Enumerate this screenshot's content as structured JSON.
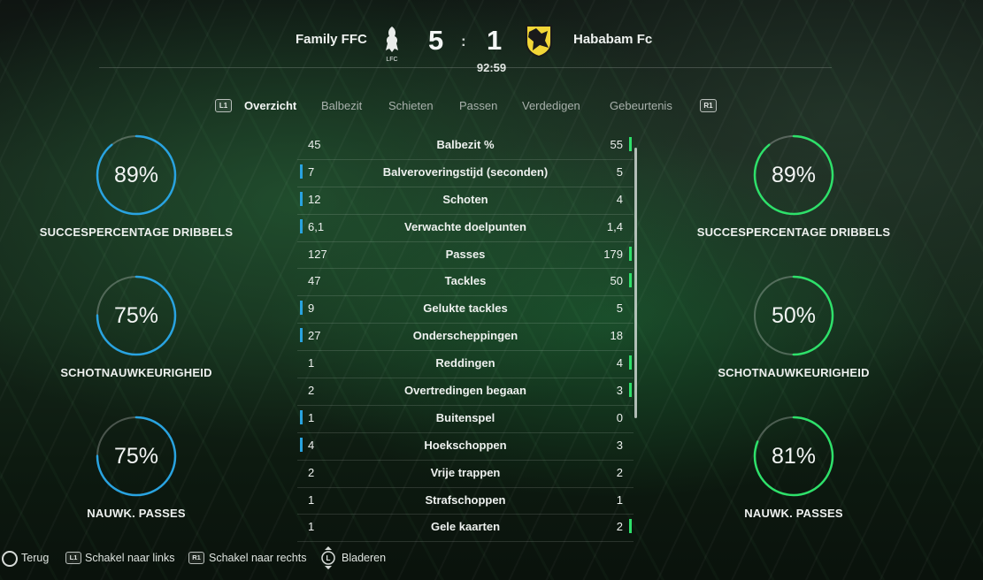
{
  "match": {
    "home_team": "Family FFC",
    "away_team": "Hababam Fc",
    "home_score": "5",
    "away_score": "1",
    "separator": ":",
    "clock": "92:59",
    "home_crest_text": "LFC"
  },
  "tabs": {
    "left_button": "L1",
    "right_button": "R1",
    "items": [
      "Overzicht",
      "Balbezit",
      "Schieten",
      "Passen",
      "Verdedigen",
      "Gebeurtenis"
    ],
    "active": "Overzicht"
  },
  "left_circles": [
    {
      "pct": "89%",
      "value": 0.89,
      "label": "SUCCESPERCENTAGE DRIBBELS"
    },
    {
      "pct": "75%",
      "value": 0.75,
      "label": "SCHOTNAUWKEURIGHEID"
    },
    {
      "pct": "75%",
      "value": 0.75,
      "label": "NAUWK. PASSES"
    }
  ],
  "right_circles": [
    {
      "pct": "89%",
      "value": 0.89,
      "label": "SUCCESPERCENTAGE DRIBBELS"
    },
    {
      "pct": "50%",
      "value": 0.5,
      "label": "SCHOTNAUWKEURIGHEID"
    },
    {
      "pct": "81%",
      "value": 0.81,
      "label": "NAUWK. PASSES"
    }
  ],
  "colors": {
    "home_accent": "#29a3e0",
    "away_accent": "#2ee06a"
  },
  "stats": [
    {
      "left": "45",
      "name": "Balbezit %",
      "right": "55",
      "leader": "right"
    },
    {
      "left": "7",
      "name": "Balveroveringstijd (seconden)",
      "right": "5",
      "leader": "left"
    },
    {
      "left": "12",
      "name": "Schoten",
      "right": "4",
      "leader": "left"
    },
    {
      "left": "6,1",
      "name": "Verwachte doelpunten",
      "right": "1,4",
      "leader": "left"
    },
    {
      "left": "127",
      "name": "Passes",
      "right": "179",
      "leader": "right"
    },
    {
      "left": "47",
      "name": "Tackles",
      "right": "50",
      "leader": "right"
    },
    {
      "left": "9",
      "name": "Gelukte tackles",
      "right": "5",
      "leader": "left"
    },
    {
      "left": "27",
      "name": "Onderscheppingen",
      "right": "18",
      "leader": "left"
    },
    {
      "left": "1",
      "name": "Reddingen",
      "right": "4",
      "leader": "right"
    },
    {
      "left": "2",
      "name": "Overtredingen begaan",
      "right": "3",
      "leader": "right"
    },
    {
      "left": "1",
      "name": "Buitenspel",
      "right": "0",
      "leader": "left"
    },
    {
      "left": "4",
      "name": "Hoekschoppen",
      "right": "3",
      "leader": "left"
    },
    {
      "left": "2",
      "name": "Vrije trappen",
      "right": "2",
      "leader": "none"
    },
    {
      "left": "1",
      "name": "Strafschoppen",
      "right": "1",
      "leader": "none"
    },
    {
      "left": "1",
      "name": "Gele kaarten",
      "right": "2",
      "leader": "right"
    }
  ],
  "footer": {
    "back": "Terug",
    "left_key": "L1",
    "left_label": "Schakel naar links",
    "right_key": "R1",
    "right_label": "Schakel naar rechts",
    "stick_key": "L",
    "scroll_label": "Bladeren"
  }
}
